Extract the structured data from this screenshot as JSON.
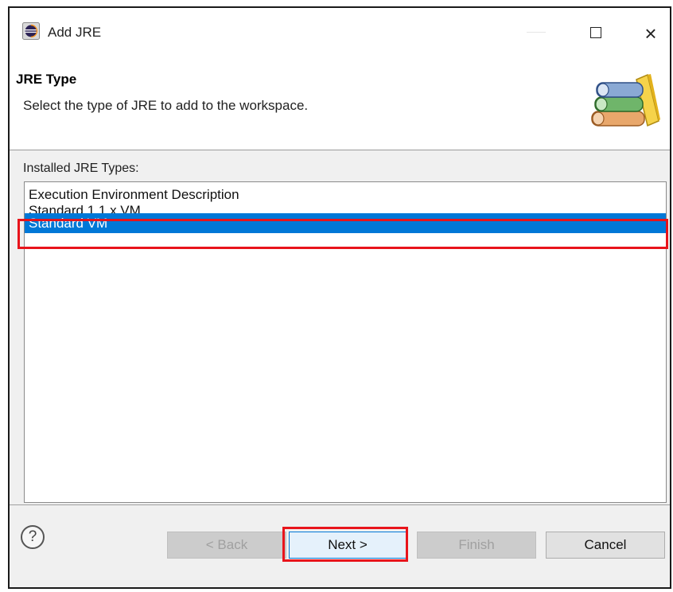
{
  "window": {
    "title": "Add JRE",
    "close_glyph": "×"
  },
  "header": {
    "title": "JRE Type",
    "description": "Select the type of JRE to add to the workspace."
  },
  "installed": {
    "label": "Installed JRE Types:",
    "items": [
      {
        "label": "Execution Environment Description",
        "selected": false
      },
      {
        "label": "Standard 1.1.x VM",
        "selected": false
      },
      {
        "label": "Standard VM",
        "selected": true
      }
    ]
  },
  "footer": {
    "help_glyph": "?",
    "back_label": "< Back",
    "next_label": "Next >",
    "finish_label": "Finish",
    "cancel_label": "Cancel"
  },
  "colors": {
    "selection": "#0078d7",
    "annotation_red": "#e8141b"
  },
  "icons": {
    "app": "eclipse-icon",
    "header": "books-icon",
    "help": "help-icon"
  }
}
